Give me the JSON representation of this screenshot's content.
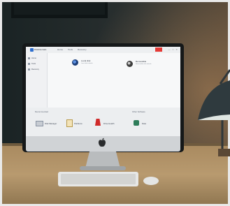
{
  "app": {
    "title": "DiskInternals",
    "menu": [
      "Home",
      "Tools",
      "Recovery"
    ]
  },
  "window_controls": "— □ ✕",
  "sidebar": {
    "items": [
      {
        "label": "Home"
      },
      {
        "label": "Tools"
      },
      {
        "label": "Recovery"
      }
    ]
  },
  "disks": [
    {
      "title": "Local disk",
      "subtitle": "Local disk details"
    },
    {
      "title": "Removable",
      "subtitle": "Removable disk details"
    }
  ],
  "tools_section": {
    "label": "Recommended",
    "tools": [
      {
        "label": "Disk Manager"
      },
      {
        "label": "Partitions"
      },
      {
        "label": "Drive Health"
      }
    ]
  },
  "other_section": {
    "label": "Other Software",
    "tools": [
      {
        "label": "Data"
      }
    ]
  },
  "colors": {
    "accent": "#2f6fcf",
    "close": "#e53935",
    "tool_red": "#d02a2a",
    "lamp_light": "#dfe6e2"
  }
}
